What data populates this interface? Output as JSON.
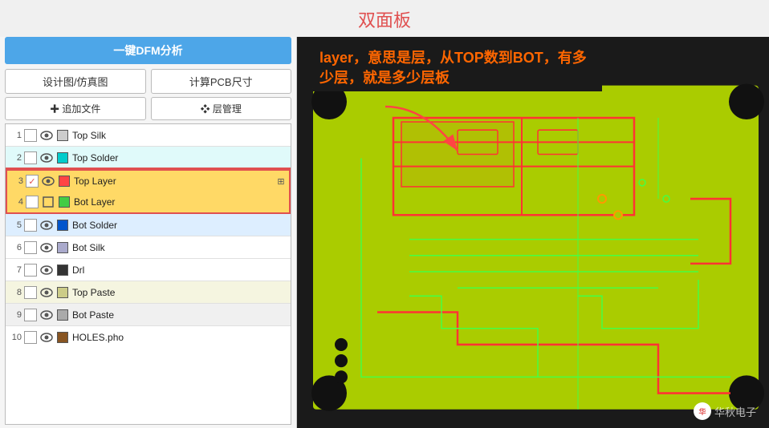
{
  "title": "双面板",
  "left_panel": {
    "dfm_button": "一键DFM分析",
    "design_view_btn": "设计图/仿真图",
    "calc_pcb_btn": "计算PCB尺寸",
    "add_file_btn": "✚ 追加文件",
    "layer_manage_btn": "❖ 层管理",
    "layers": [
      {
        "num": "1",
        "checked": false,
        "icon": "eye",
        "color": "#cccccc",
        "name": "Top Silk",
        "bg": "#ffffff",
        "highlight": false
      },
      {
        "num": "2",
        "checked": false,
        "icon": "eye",
        "color": "#00cccc",
        "name": "Top Solder",
        "bg": "#e0fafa",
        "highlight": false
      },
      {
        "num": "3",
        "checked": true,
        "icon": "eye",
        "color": "#ff4444",
        "name": "Top Layer",
        "bg": "#ffd966",
        "highlight": true,
        "expand": "⊞"
      },
      {
        "num": "4",
        "checked": false,
        "icon": "square",
        "color": "#44cc44",
        "name": "Bot Layer",
        "bg": "#ffd966",
        "highlight": true
      },
      {
        "num": "5",
        "checked": false,
        "icon": "eye",
        "color": "#0055cc",
        "name": "Bot Solder",
        "bg": "#ddeeff",
        "highlight": false
      },
      {
        "num": "6",
        "checked": false,
        "icon": "eye",
        "color": "#aaaacc",
        "name": "Bot Silk",
        "bg": "#ffffff",
        "highlight": false
      },
      {
        "num": "7",
        "checked": false,
        "icon": "eye",
        "color": "#333333",
        "name": "Drl",
        "bg": "#ffffff",
        "highlight": false
      },
      {
        "num": "8",
        "checked": false,
        "icon": "eye",
        "color": "#cccc88",
        "name": "Top Paste",
        "bg": "#f5f5e0",
        "highlight": false
      },
      {
        "num": "9",
        "checked": false,
        "icon": "eye",
        "color": "#aaaaaa",
        "name": "Bot Paste",
        "bg": "#f0f0f0",
        "highlight": false
      },
      {
        "num": "10",
        "checked": false,
        "icon": "eye",
        "color": "#885522",
        "name": "HOLES.pho",
        "bg": "#ffffff",
        "highlight": false
      }
    ]
  },
  "right_panel": {
    "annotation": "layer，意思是层，从TOP数到BOT，有多少层，就是多少层板",
    "watermark": "华秋电子"
  }
}
